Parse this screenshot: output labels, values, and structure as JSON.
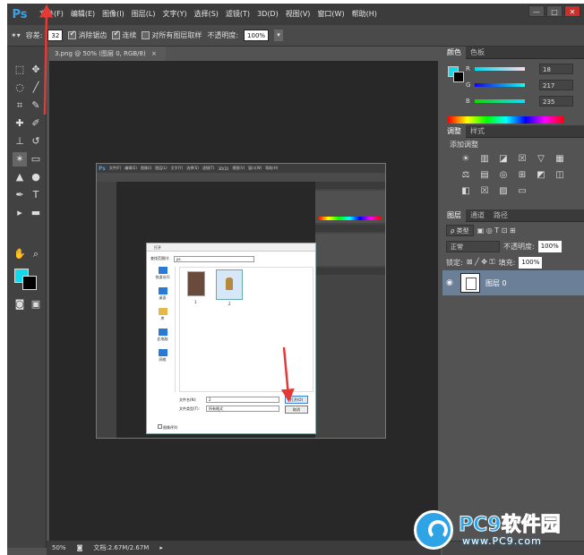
{
  "app": {
    "logo": "Ps",
    "menus": [
      "文件(F)",
      "编辑(E)",
      "图像(I)",
      "图层(L)",
      "文字(Y)",
      "选择(S)",
      "滤镜(T)",
      "3D(D)",
      "视图(V)",
      "窗口(W)",
      "帮助(H)"
    ],
    "win_controls": [
      "—",
      "□",
      "✕"
    ]
  },
  "options": {
    "size_label": "容差:",
    "size_value": "32",
    "antialias_label": "消除锯齿",
    "contiguous_label": "连续",
    "sample_all_label": "对所有图层取样",
    "opacity_label": "不透明度:",
    "opacity_value": "100%"
  },
  "document": {
    "tab_title": "3.png @ 50% (图层 0, RGB/8)",
    "tab_close": "×"
  },
  "status": {
    "zoom": "50%",
    "doc_info": "文档:2.67M/2.67M"
  },
  "colors": {
    "foreground": "#12d9eb",
    "background": "#000000",
    "accent_arrow": "#e53935"
  },
  "color_panel": {
    "tabs": [
      "颜色",
      "色板"
    ],
    "channels": [
      {
        "label": "R",
        "value": "18"
      },
      {
        "label": "G",
        "value": "217"
      },
      {
        "label": "B",
        "value": "235"
      }
    ]
  },
  "adjust_panel": {
    "tabs": [
      "调整",
      "样式"
    ],
    "title": "添加调整",
    "icons": [
      "brightness-icon",
      "levels-icon",
      "curves-icon",
      "exposure-icon",
      "vibrance-icon",
      "hue-icon",
      "color-balance-icon",
      "bw-icon",
      "photo-filter-icon",
      "channel-mixer-icon",
      "lookup-icon",
      "invert-icon",
      "posterize-icon",
      "threshold-icon",
      "gradient-map-icon",
      "selective-color-icon"
    ],
    "glyphs": [
      "☀",
      "▥",
      "◪",
      "☒",
      "▽",
      "▦",
      "⚖",
      "▤",
      "◎",
      "⊞",
      "◩",
      "◫",
      "◧",
      "☒",
      "▨",
      "▭"
    ]
  },
  "layers_panel": {
    "tabs": [
      "图层",
      "通道",
      "路径"
    ],
    "filter_label": "ρ 类型",
    "blend_mode": "正常",
    "opacity_label": "不透明度:",
    "opacity_value": "100%",
    "lock_label": "锁定:",
    "fill_label": "填充:",
    "fill_value": "100%",
    "layer_name": "图层 0"
  },
  "dialog": {
    "title": "打开",
    "look_in_label": "查找范围(I):",
    "folder": "ps",
    "sidebar": [
      "快速访问",
      "桌面",
      "库",
      "此电脑",
      "网络"
    ],
    "files": [
      "1",
      "2"
    ],
    "filename_label": "文件名(N):",
    "filename_value": "2",
    "filetype_label": "文件类型(T):",
    "filetype_value": "所有格式",
    "open_button": "打开(O)",
    "cancel_button": "取消",
    "sequence_label": "图像序列"
  },
  "watermark": {
    "brand": "PC9软件园",
    "url": "www.PC9.com"
  }
}
